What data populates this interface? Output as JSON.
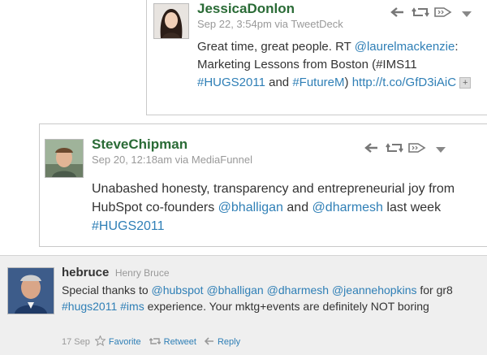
{
  "tweets": [
    {
      "handle": "JessicaDonlon",
      "meta": "Sep 22, 3:54pm via TweetDeck",
      "text_parts": [
        "Great time, great people. RT",
        "@laurelmackenzie",
        ": Marketing Lessons from Boston (#IMS11 ",
        "#HUGS2011",
        " and ",
        "#FutureM",
        ") ",
        "http://t.co/GfD3iAiC"
      ],
      "expand_glyph": "+"
    },
    {
      "handle": "SteveChipman",
      "meta": "Sep 20, 12:18am via MediaFunnel",
      "text_parts": [
        "Unabashed honesty, transparency and entrepreneurial joy from HubSpot co-founders ",
        "@bhalligan",
        " and ",
        "@dharmesh",
        " last week ",
        "#HUGS2011"
      ]
    },
    {
      "handle": "hebruce",
      "fullname": "Henry Bruce",
      "text_parts": [
        "Special thanks to ",
        "@hubspot",
        " ",
        "@bhalligan",
        " ",
        "@dharmesh",
        " ",
        "@jeannehopkins",
        " for gr8 ",
        "#hugs2011",
        " ",
        "#ims",
        " experience. Your mktg+events are definitely NOT boring"
      ],
      "footer": {
        "date": "17 Sep",
        "favorite": "Favorite",
        "retweet": "Retweet",
        "reply": "Reply"
      }
    }
  ],
  "icons": [
    "reply-icon",
    "retweet-icon",
    "more-icon",
    "dropdown-icon",
    "star-icon"
  ],
  "colors": {
    "link": "#2f7fb6",
    "handle": "#2a6b36",
    "meta": "#999999"
  }
}
